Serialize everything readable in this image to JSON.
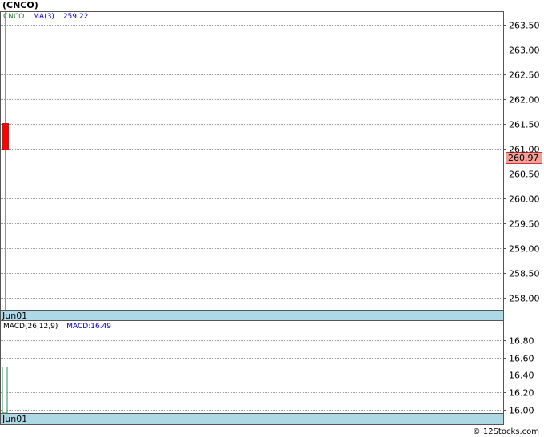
{
  "title": "(CNCO)",
  "chart_data": [
    {
      "type": "candlestick",
      "legend": {
        "symbol": "CNCO",
        "ma_label": "MA(3)",
        "ma_value": "259.22"
      },
      "x": [
        "Jun01"
      ],
      "candles": [
        {
          "date": "Jun01",
          "open": 261.5,
          "close": 260.97,
          "high": 263.75,
          "low": 257.75
        }
      ],
      "ylim": [
        257.75,
        263.75
      ],
      "yticks": [
        "258.00",
        "258.50",
        "259.00",
        "259.50",
        "260.00",
        "260.50",
        "261.00",
        "261.50",
        "262.00",
        "262.50",
        "263.00",
        "263.50"
      ],
      "last_price": "260.97",
      "xlabel": "Jun01",
      "grid": true,
      "colors": {
        "down": "#ff0000",
        "wick": "#8b0000",
        "last_price_bg": "#f4a09a",
        "date_bar": "#add8e6"
      }
    },
    {
      "type": "bar",
      "legend": {
        "label": "MACD(26,12,9)",
        "macd_label": "MACD:16.49"
      },
      "x": [
        "Jun01"
      ],
      "values": [
        16.49
      ],
      "ylim": [
        15.96,
        17.02
      ],
      "yticks": [
        "16.00",
        "16.20",
        "16.40",
        "16.60",
        "16.80"
      ],
      "xlabel": "Jun01",
      "grid": true,
      "colors": {
        "bar": "#2e8b57",
        "macd_text": "#0000cc"
      }
    }
  ],
  "footer": "© 12Stocks.com"
}
